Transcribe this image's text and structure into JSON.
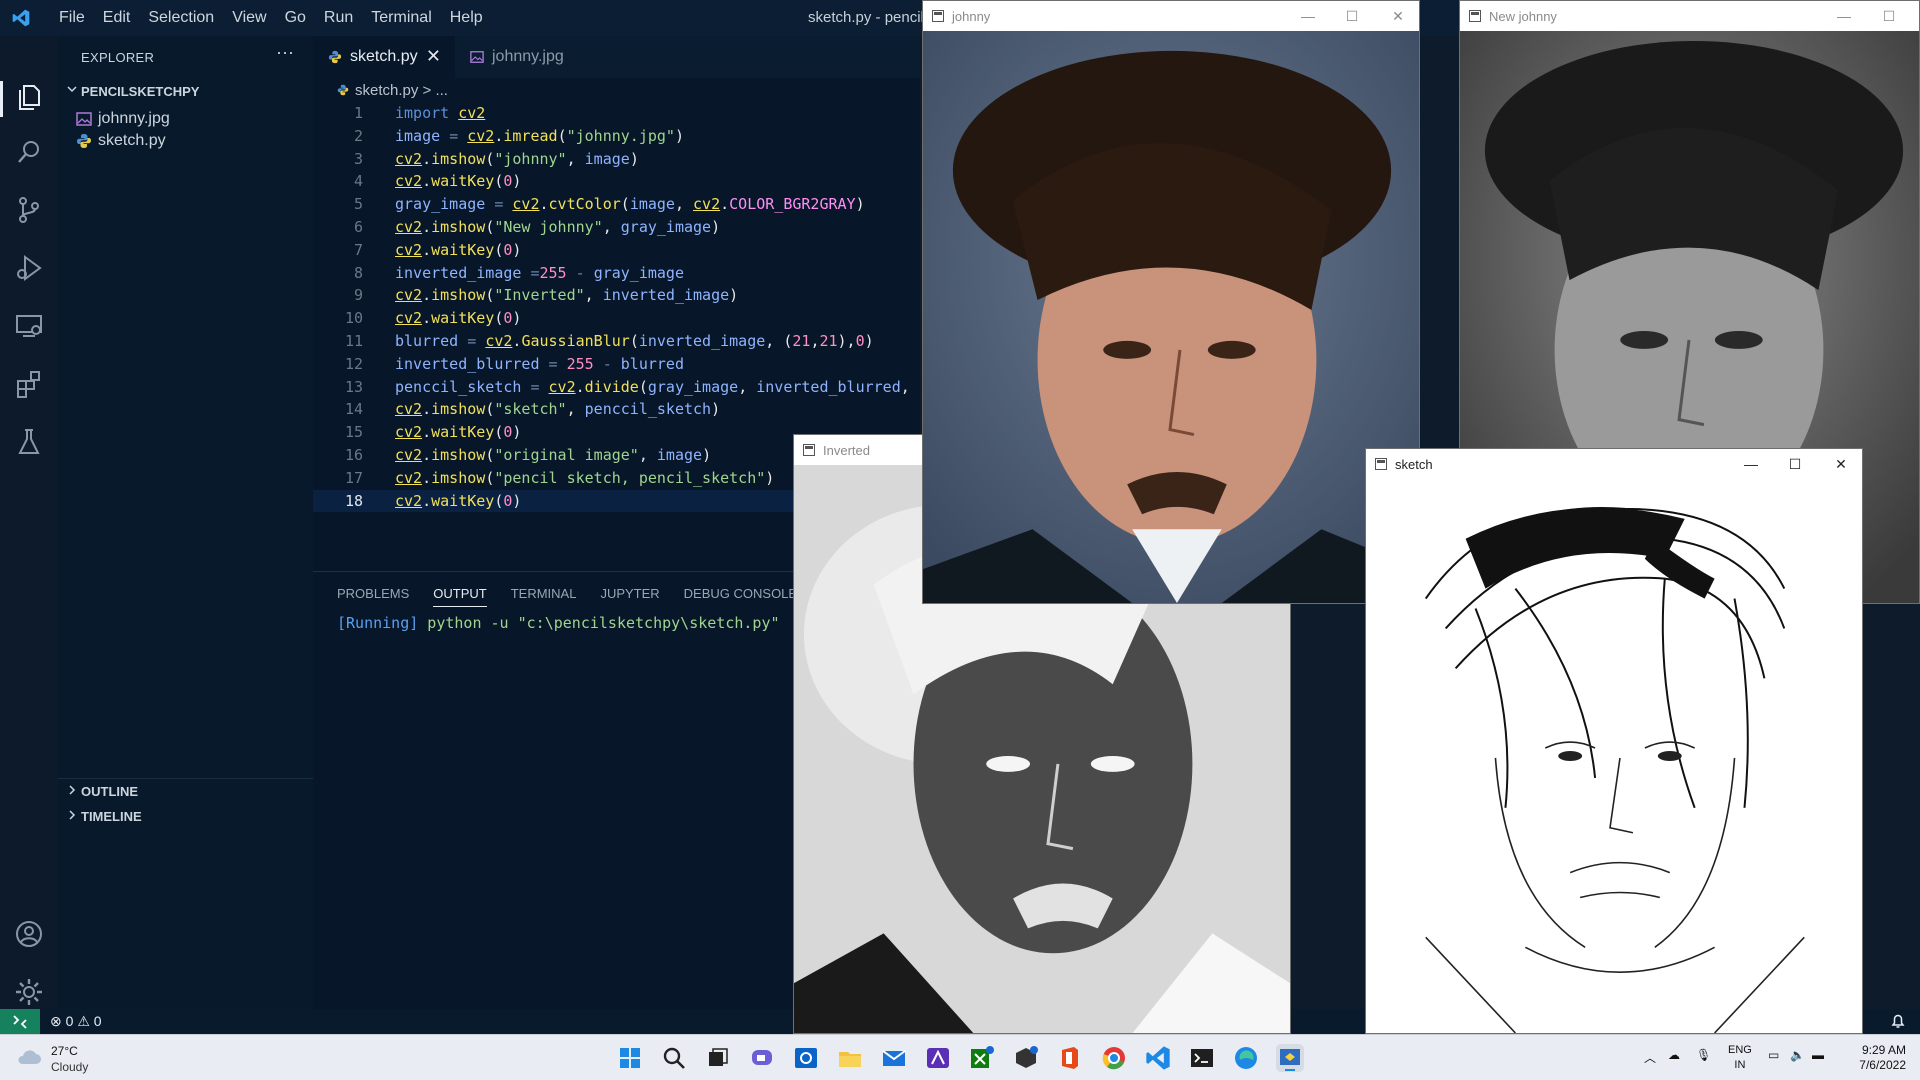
{
  "vscode": {
    "menu": [
      "File",
      "Edit",
      "Selection",
      "View",
      "Go",
      "Run",
      "Terminal",
      "Help"
    ],
    "window_title": "sketch.py - pencil",
    "activity_icons": [
      "files-icon",
      "search-icon",
      "source-control-icon",
      "run-debug-icon",
      "remote-explorer-icon",
      "extensions-icon",
      "testing-icon",
      "account-icon",
      "settings-gear-icon"
    ],
    "explorer": {
      "title": "EXPLORER",
      "more": "···",
      "project": "PENCILSKETCHPY",
      "files": [
        "johnny.jpg",
        "sketch.py"
      ],
      "outline": "OUTLINE",
      "timeline": "TIMELINE"
    },
    "tabs": [
      {
        "label": "sketch.py",
        "active": true
      },
      {
        "label": "johnny.jpg",
        "active": false
      }
    ],
    "breadcrumb": {
      "file": "sketch.py",
      "rest": "> ..."
    },
    "line_numbers": [
      "1",
      "2",
      "3",
      "4",
      "5",
      "6",
      "7",
      "8",
      "9",
      "10",
      "11",
      "12",
      "13",
      "14",
      "15",
      "16",
      "17",
      "18"
    ],
    "current_line": 18,
    "panel": {
      "tabs": [
        "PROBLEMS",
        "OUTPUT",
        "TERMINAL",
        "JUPYTER",
        "DEBUG CONSOLE"
      ],
      "active_tab": "OUTPUT",
      "output_running": "[Running]",
      "output_command": " python -u \"c:\\pencilsketchpy\\sketch.py\""
    },
    "status": {
      "errors": "0",
      "warnings": "0"
    }
  },
  "windows": {
    "johnny": {
      "title": "johnny"
    },
    "new_johnny": {
      "title": "New johnny"
    },
    "inverted": {
      "title": "Inverted"
    },
    "sketch": {
      "title": "sketch"
    },
    "controls": {
      "minimize": "—",
      "maximize": "☐",
      "close": "✕"
    }
  },
  "taskbar": {
    "weather_temp": "27°C",
    "weather_cond": "Cloudy",
    "lang_1": "ENG",
    "lang_2": "IN",
    "time": "9:29 AM",
    "date": "7/6/2022"
  }
}
